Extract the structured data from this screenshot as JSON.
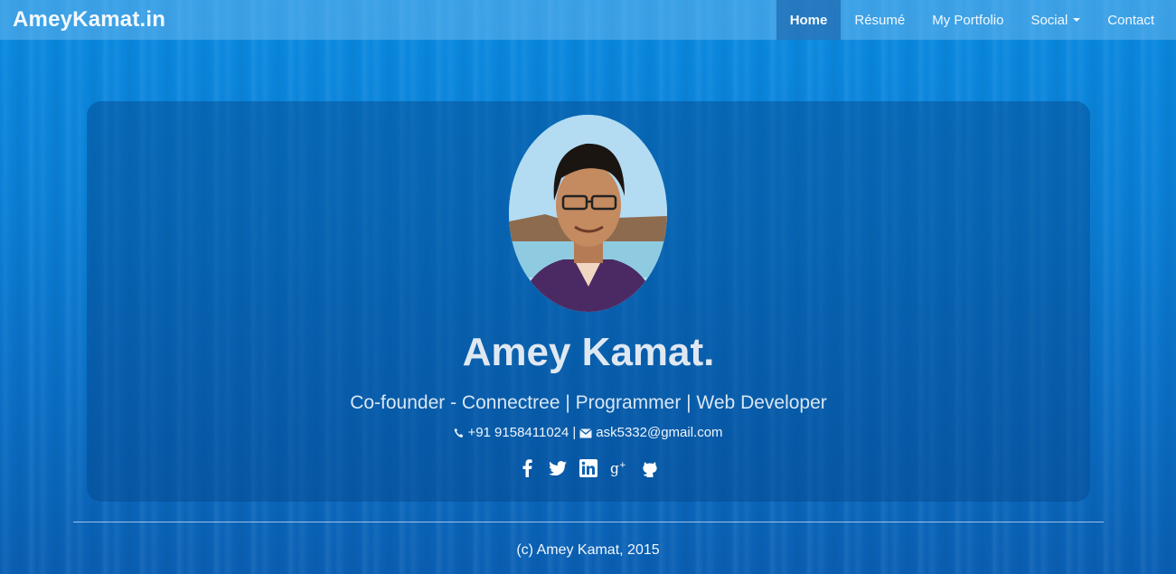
{
  "brand": "AmeyKamat.in",
  "nav": {
    "home": "Home",
    "resume": "Résumé",
    "portfolio": "My Portfolio",
    "social": "Social",
    "contact": "Contact"
  },
  "profile": {
    "name": "Amey Kamat.",
    "tagline": "Co-founder - Connectree | Programmer | Web Developer",
    "phone": "+91 9158411024",
    "separator": "|",
    "email": "ask5332@gmail.com"
  },
  "social_icons": [
    "facebook-icon",
    "twitter-icon",
    "linkedin-icon",
    "google-plus-icon",
    "github-icon"
  ],
  "footer": "(c) Amey Kamat, 2015",
  "colors": {
    "background": "#0a7fd5",
    "navbar_active": "#1e5f9e",
    "card": "#0a4c8e"
  }
}
